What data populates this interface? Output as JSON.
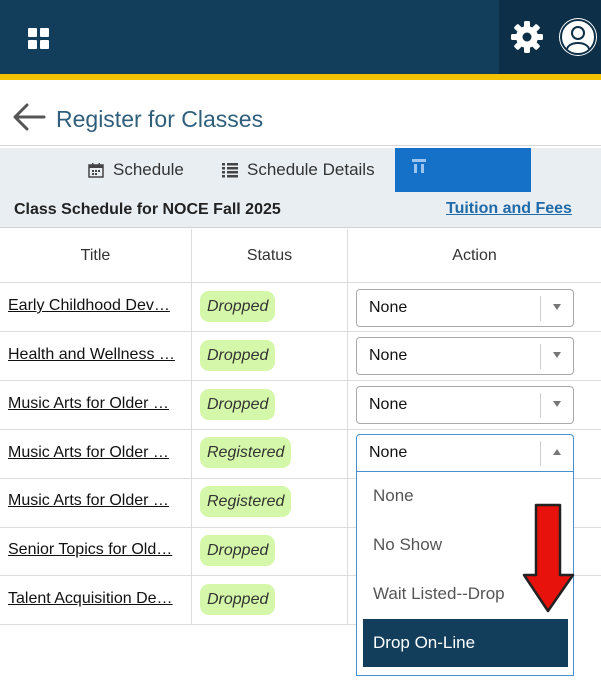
{
  "header": {
    "apps_icon": "grid-icon",
    "settings_icon": "gear-icon",
    "user_icon": "user-avatar-icon",
    "brand_color": "#123e5c",
    "accent_color": "#f2c200"
  },
  "page": {
    "title": "Register for Classes",
    "back_icon": "arrow-left-icon"
  },
  "tabs": [
    {
      "label": "Schedule",
      "icon": "calendar-icon",
      "active": false
    },
    {
      "label": "Schedule Details",
      "icon": "list-icon",
      "active": false
    },
    {
      "label": "",
      "icon": "summary-icon",
      "active": true
    }
  ],
  "schedule": {
    "title": "Class Schedule for NOCE Fall 2025",
    "tuition_link": "Tuition and Fees"
  },
  "table": {
    "columns": [
      "Title",
      "Status",
      "Action"
    ],
    "rows": [
      {
        "title": "Early Childhood Dev…",
        "status": "Dropped",
        "action": "None"
      },
      {
        "title": "Health and Wellness …",
        "status": "Dropped",
        "action": "None"
      },
      {
        "title": "Music Arts for Older …",
        "status": "Dropped",
        "action": "None"
      },
      {
        "title": "Music Arts for Older …",
        "status": "Registered",
        "action": "None"
      },
      {
        "title": "Music Arts for Older …",
        "status": "Registered",
        "action": ""
      },
      {
        "title": "Senior Topics for Old…",
        "status": "Dropped",
        "action": ""
      },
      {
        "title": "Talent Acquisition De…",
        "status": "Dropped",
        "action": ""
      }
    ]
  },
  "dropdown": {
    "options": [
      "None",
      "No Show",
      "Wait Listed--Drop",
      "Drop On-Line"
    ],
    "highlighted": "Drop On-Line",
    "highlight_color": "#123e5c"
  },
  "annotation": {
    "arrow_color": "#e8120c"
  }
}
